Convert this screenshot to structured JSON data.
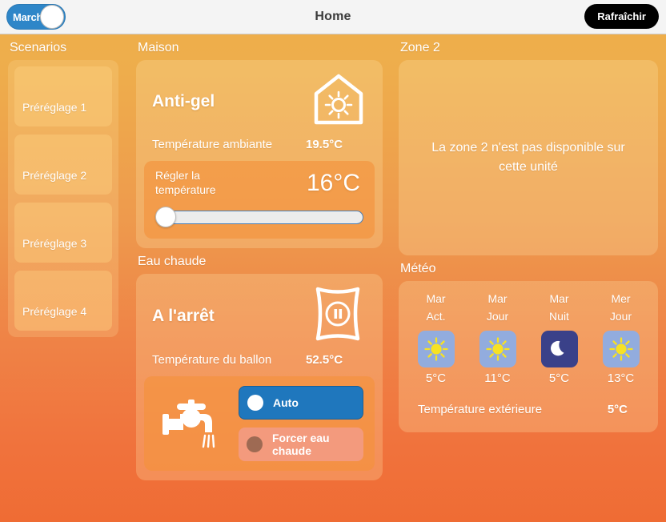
{
  "header": {
    "title": "Home",
    "power_toggle_label": "Marche",
    "refresh_label": "Rafraîchir"
  },
  "sidebar": {
    "title": "Scenarios",
    "presets": [
      {
        "label": "Préréglage 1"
      },
      {
        "label": "Préréglage 2"
      },
      {
        "label": "Préréglage 3"
      },
      {
        "label": "Préréglage 4"
      }
    ]
  },
  "house": {
    "section_title": "Maison",
    "state": "Anti-gel",
    "icon": "house-sun-icon",
    "ambient_label": "Température ambiante",
    "ambient_value": "19.5°C",
    "setpoint_label": "Régler la température",
    "setpoint_value": "16°C",
    "slider_position_percent": 0
  },
  "hot_water": {
    "section_title": "Eau chaude",
    "state": "A l'arrêt",
    "icon": "water-tank-pause-icon",
    "tank_label": "Température du ballon",
    "tank_value": "52.5°C",
    "faucet_icon": "faucet-icon",
    "modes": [
      {
        "label": "Auto",
        "selected": true
      },
      {
        "label": "Forcer eau chaude",
        "selected": false
      }
    ]
  },
  "zone2": {
    "section_title": "Zone 2",
    "message": "La zone 2 n'est pas disponible sur cette unité"
  },
  "weather": {
    "section_title": "Météo",
    "forecast": [
      {
        "day": "Mar",
        "part": "Act.",
        "icon": "sun-icon",
        "temp": "5°C"
      },
      {
        "day": "Mar",
        "part": "Jour",
        "icon": "sun-icon",
        "temp": "11°C"
      },
      {
        "day": "Mar",
        "part": "Nuit",
        "icon": "moon-icon",
        "temp": "5°C"
      },
      {
        "day": "Mer",
        "part": "Jour",
        "icon": "sun-icon",
        "temp": "13°C"
      }
    ],
    "outdoor_label": "Température extérieure",
    "outdoor_value": "5°C"
  },
  "colors": {
    "accent_blue": "#1f77bd",
    "toggle_on": "#2e86c8",
    "refresh_bg": "#000000",
    "night_bg": "#3a4189",
    "day_bg": "#92acde",
    "sun_yellow": "#f7e224",
    "force_button": "#f39a7d",
    "force_dot": "#9e6a53"
  }
}
